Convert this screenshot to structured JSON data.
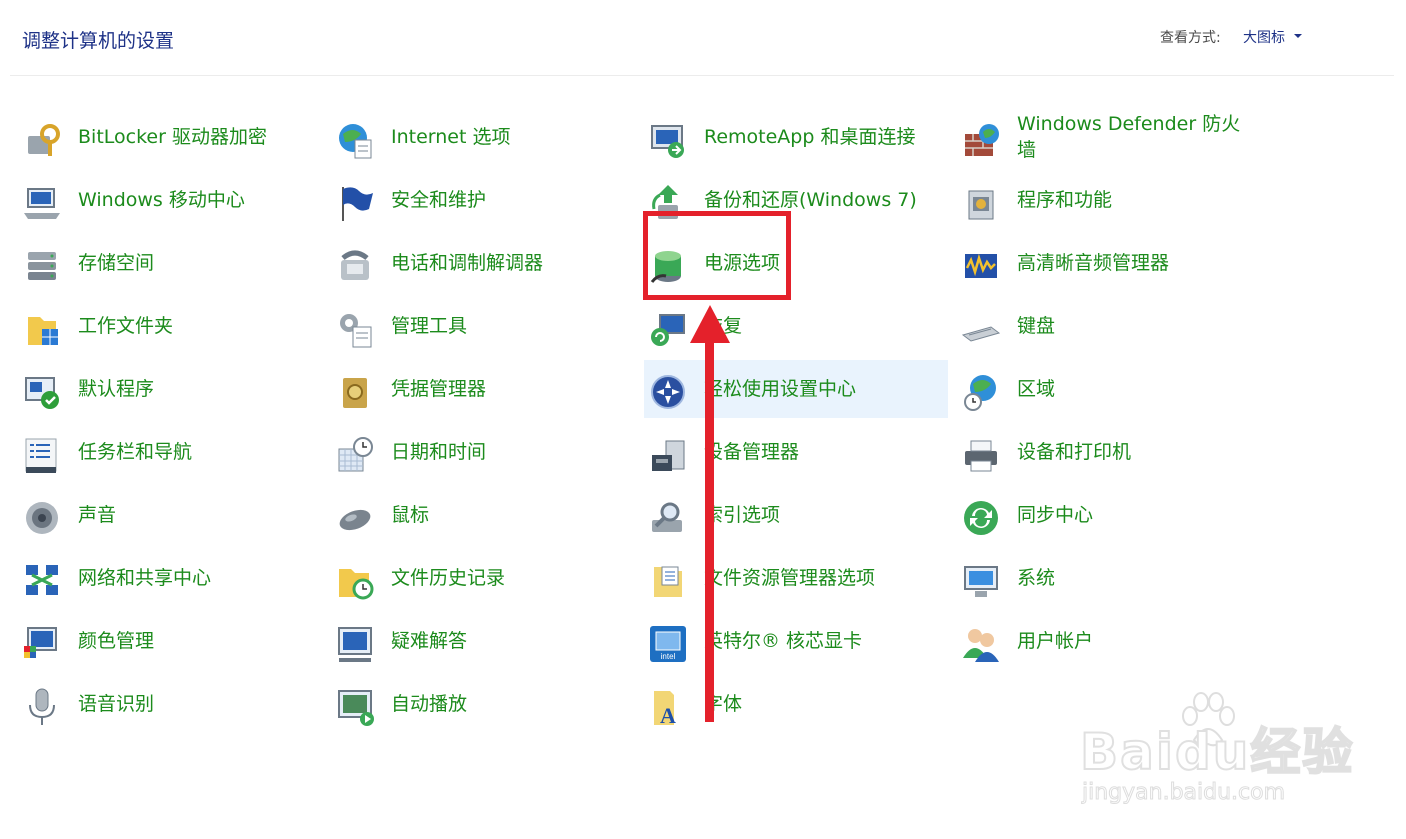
{
  "header": {
    "title": "调整计算机的设置",
    "view_by_label": "查看方式:",
    "view_by_value": "大图标"
  },
  "items": [
    {
      "label": "BitLocker 驱动器加密",
      "icon": "bitlocker-icon"
    },
    {
      "label": "Internet 选项",
      "icon": "internet-options-icon"
    },
    {
      "label": "RemoteApp 和桌面连接",
      "icon": "remoteapp-icon"
    },
    {
      "label": "Windows Defender 防火墙",
      "icon": "firewall-icon"
    },
    {
      "label": "Windows 移动中心",
      "icon": "mobility-center-icon"
    },
    {
      "label": "安全和维护",
      "icon": "security-flag-icon"
    },
    {
      "label": "备份和还原(Windows 7)",
      "icon": "backup-restore-icon"
    },
    {
      "label": "程序和功能",
      "icon": "programs-features-icon"
    },
    {
      "label": "存储空间",
      "icon": "storage-spaces-icon"
    },
    {
      "label": "电话和调制解调器",
      "icon": "phone-modem-icon"
    },
    {
      "label": "电源选项",
      "icon": "power-options-icon"
    },
    {
      "label": "高清晰音频管理器",
      "icon": "audio-manager-icon"
    },
    {
      "label": "工作文件夹",
      "icon": "work-folders-icon"
    },
    {
      "label": "管理工具",
      "icon": "admin-tools-icon"
    },
    {
      "label": "恢复",
      "icon": "recovery-icon"
    },
    {
      "label": "键盘",
      "icon": "keyboard-icon"
    },
    {
      "label": "默认程序",
      "icon": "default-programs-icon"
    },
    {
      "label": "凭据管理器",
      "icon": "credential-manager-icon"
    },
    {
      "label": "轻松使用设置中心",
      "icon": "ease-of-access-icon"
    },
    {
      "label": "区域",
      "icon": "region-icon"
    },
    {
      "label": "任务栏和导航",
      "icon": "taskbar-icon"
    },
    {
      "label": "日期和时间",
      "icon": "date-time-icon"
    },
    {
      "label": "设备管理器",
      "icon": "device-manager-icon"
    },
    {
      "label": "设备和打印机",
      "icon": "devices-printers-icon"
    },
    {
      "label": "声音",
      "icon": "sound-icon"
    },
    {
      "label": "鼠标",
      "icon": "mouse-icon"
    },
    {
      "label": "索引选项",
      "icon": "indexing-options-icon"
    },
    {
      "label": "同步中心",
      "icon": "sync-center-icon"
    },
    {
      "label": "网络和共享中心",
      "icon": "network-sharing-icon"
    },
    {
      "label": "文件历史记录",
      "icon": "file-history-icon"
    },
    {
      "label": "文件资源管理器选项",
      "icon": "explorer-options-icon"
    },
    {
      "label": "系统",
      "icon": "system-icon"
    },
    {
      "label": "颜色管理",
      "icon": "color-management-icon"
    },
    {
      "label": "疑难解答",
      "icon": "troubleshooting-icon"
    },
    {
      "label": "英特尔® 核芯显卡",
      "icon": "intel-graphics-icon"
    },
    {
      "label": "用户帐户",
      "icon": "user-accounts-icon"
    },
    {
      "label": "语音识别",
      "icon": "speech-recognition-icon"
    },
    {
      "label": "自动播放",
      "icon": "autoplay-icon"
    },
    {
      "label": "字体",
      "icon": "fonts-icon"
    }
  ],
  "hovered_item": "轻松使用设置中心",
  "highlighted_item": "电源选项",
  "watermark": {
    "brand": "Baidu经验",
    "url": "jingyan.baidu.com"
  },
  "colors": {
    "link_green": "#1c8b1c",
    "title_blue": "#1e3287",
    "annotation_red": "#e4212b",
    "hover_bg": "#e9f3fd"
  }
}
